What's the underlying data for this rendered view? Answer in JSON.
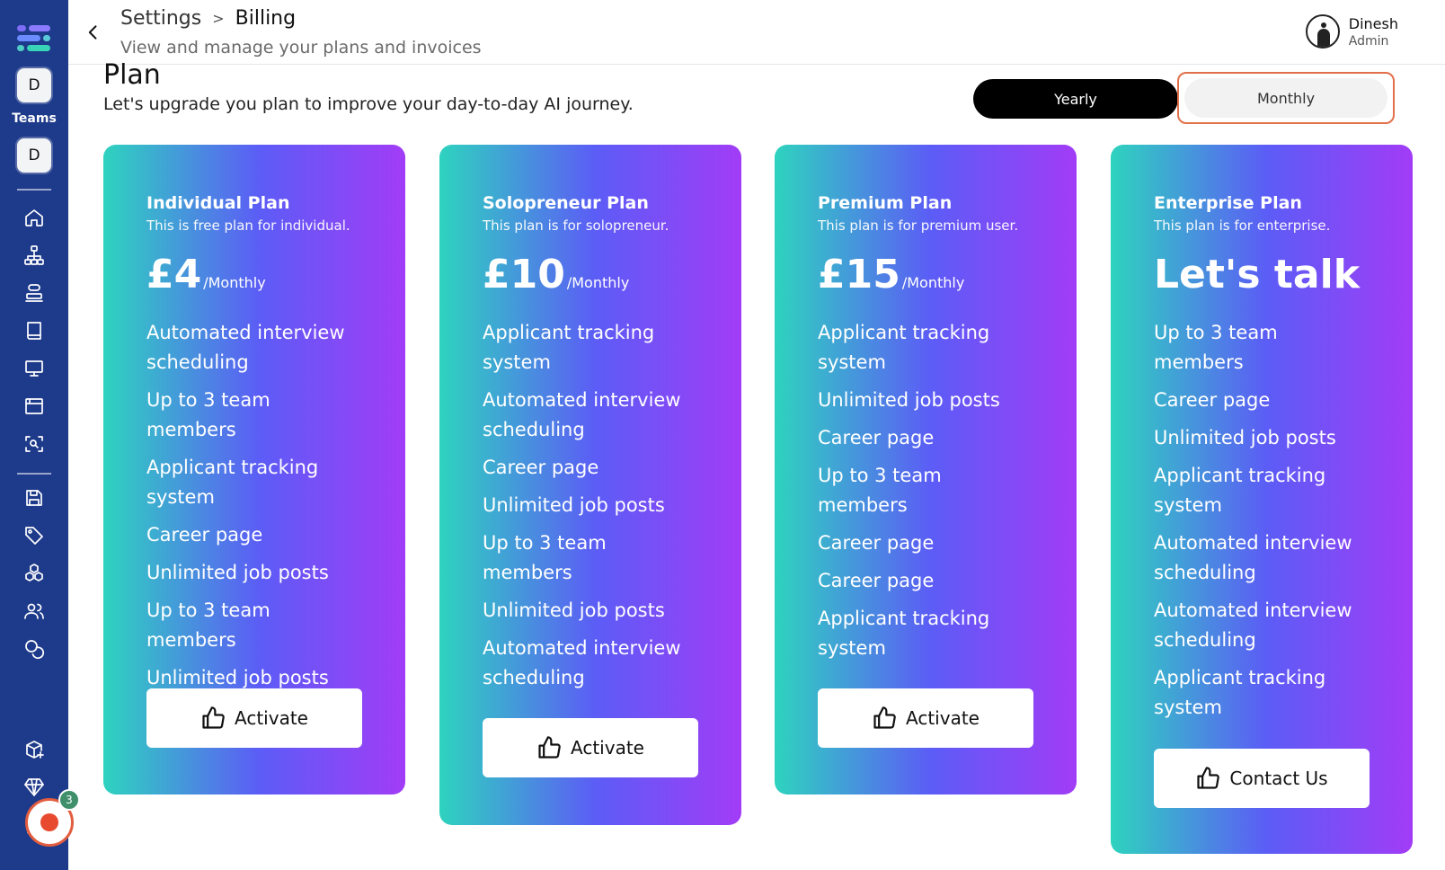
{
  "sidebar": {
    "workspace_initial": "D",
    "teams_label": "Teams",
    "team_initial": "D",
    "nav": [
      "home-icon",
      "org-chart-icon",
      "stack-icon",
      "book-icon",
      "monitor-icon",
      "browser-window-icon",
      "scan-search-icon",
      "save-icon",
      "tag-icon",
      "cubes-icon",
      "users-icon",
      "coins-icon",
      "package-plus-icon",
      "gem-icon",
      "clipboard-icon"
    ],
    "recording_count": "3"
  },
  "header": {
    "breadcrumb_parent": "Settings",
    "breadcrumb_separator": ">",
    "breadcrumb_current": "Billing",
    "subtitle": "View and manage your plans and invoices",
    "user_name": "Dinesh",
    "user_role": "Admin"
  },
  "plan": {
    "title": "Plan",
    "description": "Let's upgrade you plan to improve your day-to-day AI journey.",
    "toggle_yearly": "Yearly",
    "toggle_monthly": "Monthly",
    "selected_period": "Monthly"
  },
  "cards": [
    {
      "name": "Individual Plan",
      "subtitle": "This is free plan for individual.",
      "price": "£4",
      "period": "/Monthly",
      "features": [
        "Automated interview scheduling",
        "Up to 3 team members",
        "Applicant tracking system",
        "Career page",
        "Unlimited job posts",
        "Up to 3 team members",
        "Unlimited job posts"
      ],
      "cta": "Activate"
    },
    {
      "name": "Solopreneur Plan",
      "subtitle": "This plan is for solopreneur.",
      "price": "£10",
      "period": "/Monthly",
      "features": [
        "Applicant tracking system",
        "Automated interview scheduling",
        "Career page",
        "Unlimited job posts",
        "Up to 3 team members",
        "Unlimited job posts",
        "Automated interview scheduling"
      ],
      "cta": "Activate"
    },
    {
      "name": "Premium Plan",
      "subtitle": "This plan is for premium user.",
      "price": "£15",
      "period": "/Monthly",
      "features": [
        "Applicant tracking system",
        "Unlimited job posts",
        "Career page",
        "Up to 3 team members",
        "Career page",
        "Career page",
        "Applicant tracking system"
      ],
      "cta": "Activate"
    },
    {
      "name": "Enterprise Plan",
      "subtitle": "This plan is for enterprise.",
      "price_text": "Let's talk",
      "features": [
        "Up to 3 team members",
        "Career page",
        "Unlimited job posts",
        "Applicant tracking system",
        "Automated interview scheduling",
        "Automated interview scheduling",
        "Applicant tracking system"
      ],
      "cta": "Contact Us"
    }
  ],
  "colors": {
    "sidebar": "#1e3a8a",
    "gradient_start": "#2ed3bf",
    "gradient_mid": "#5c5cf6",
    "gradient_end": "#a23cf6",
    "toggle_active": "#000000",
    "toggle_highlight_border": "#e2704a",
    "record_red": "#e84a2f"
  }
}
